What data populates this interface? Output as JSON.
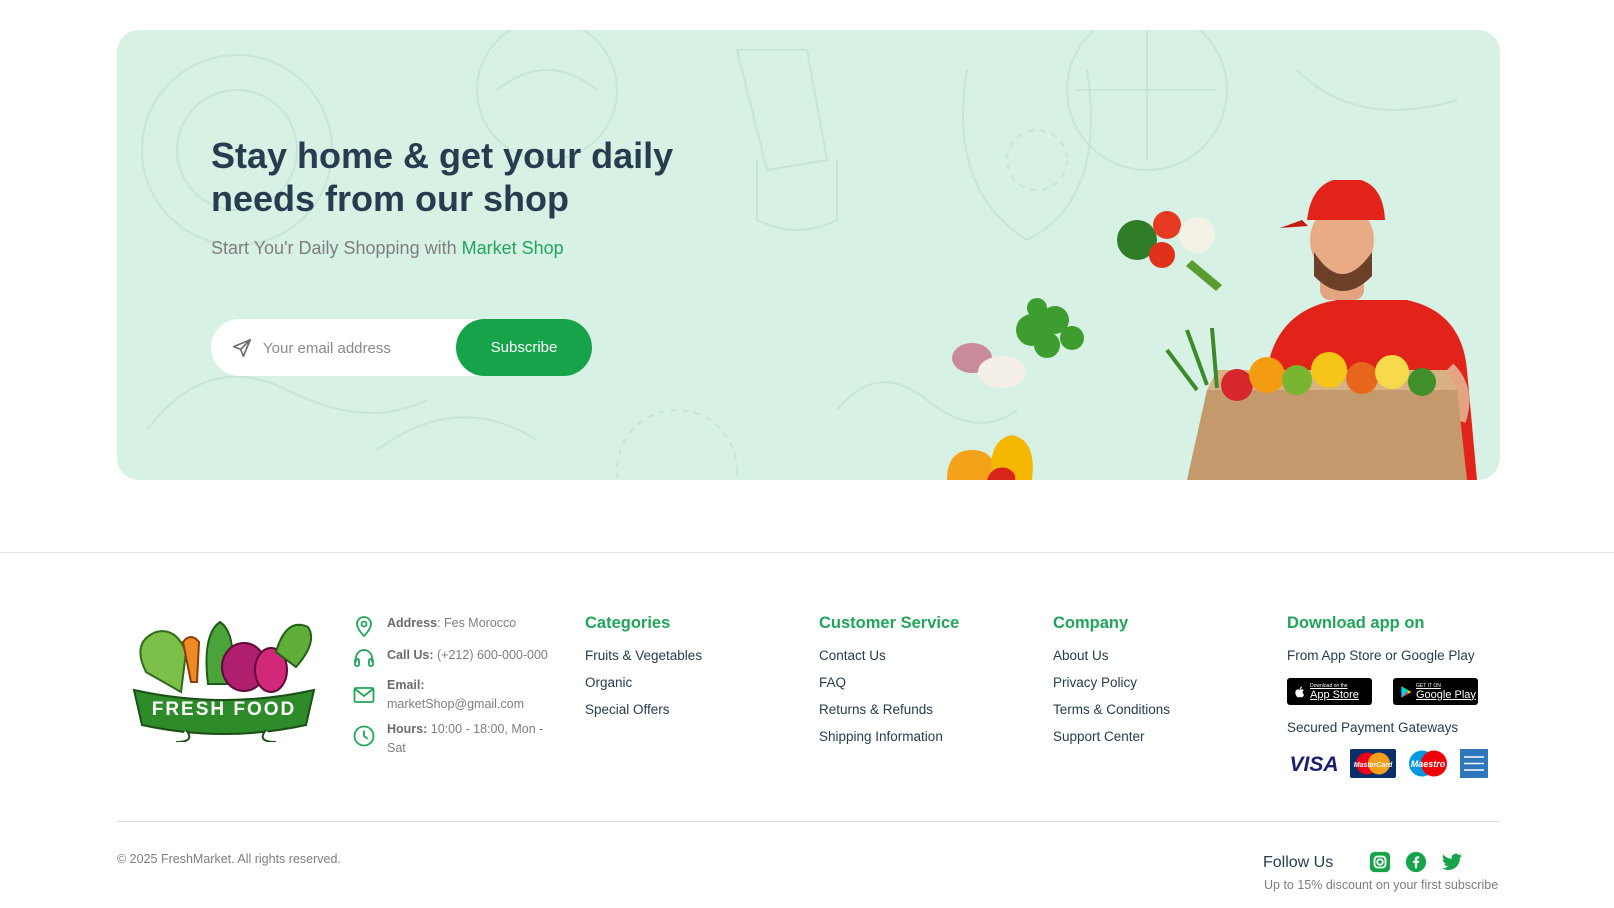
{
  "banner": {
    "title": "Stay home & get your daily needs from our shop",
    "subtitle_prefix": "Start You'r Daily Shopping with ",
    "subtitle_brand": "Market Shop",
    "email_placeholder": "Your email address",
    "email_value": "",
    "subscribe_label": "Subscribe"
  },
  "brand": {
    "logo_text": "FRESH FOOD",
    "accent_color": "#22a45a",
    "button_color": "#17a349",
    "banner_bg": "#d8f1e5"
  },
  "contact": {
    "address_label": "Address",
    "address_value": ": Fes Morocco",
    "call_label": "Call Us:",
    "call_value": " (+212) 600-000-000",
    "email_label": "Email:",
    "email_value": "marketShop@gmail.com",
    "hours_label": "Hours:",
    "hours_value": " 10:00 - 18:00, Mon - Sat"
  },
  "columns": {
    "categories": {
      "title": "Categories",
      "links": [
        "Fruits & Vegetables",
        "Organic",
        "Special Offers"
      ]
    },
    "service": {
      "title": "Customer Service",
      "links": [
        "Contact Us",
        "FAQ",
        "Returns & Refunds",
        "Shipping Information"
      ]
    },
    "company": {
      "title": "Company",
      "links": [
        "About Us",
        "Privacy Policy",
        "Terms & Conditions",
        "Support Center"
      ]
    },
    "app": {
      "title": "Download app on",
      "text": "From App Store or Google Play",
      "app_store_small": "Download on the",
      "app_store_big": "App Store",
      "google_small": "GET IT ON",
      "google_big": "Google Play",
      "payment_text": "Secured Payment Gateways",
      "payments": [
        "VISA",
        "MasterCard",
        "Maestro",
        "American Express"
      ]
    }
  },
  "footer": {
    "copyright": "© 2025 FreshMarket. All rights reserved.",
    "follow": "Follow Us",
    "socials": [
      "instagram-icon",
      "facebook-icon",
      "twitter-icon"
    ],
    "discount": "Up to 15% discount on your first subscribe"
  }
}
